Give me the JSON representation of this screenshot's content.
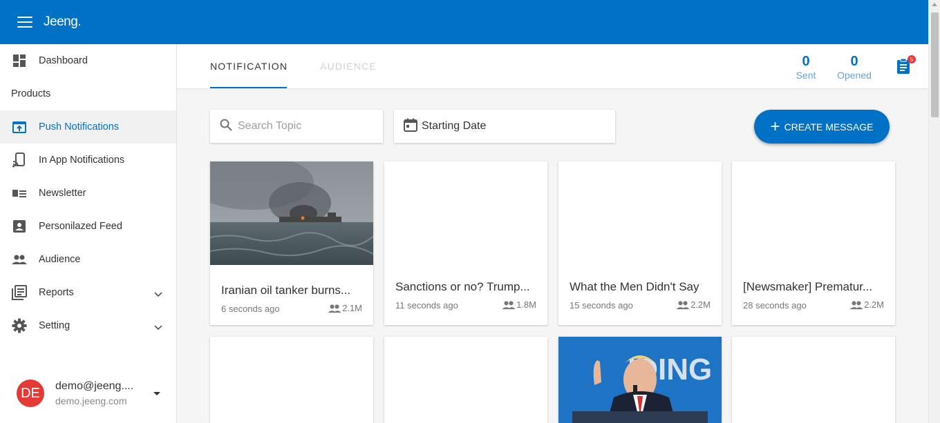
{
  "app": {
    "brand": "Jeeng."
  },
  "sidebar": {
    "items": [
      {
        "label": "Dashboard",
        "icon": "dashboard-icon"
      },
      {
        "label": "Products",
        "section": true
      },
      {
        "label": "Push Notifications",
        "icon": "push-notification-icon",
        "active": true
      },
      {
        "label": "In App Notifications",
        "icon": "cast-icon"
      },
      {
        "label": "Newsletter",
        "icon": "newsletter-icon"
      },
      {
        "label": "Personilazed Feed",
        "icon": "person-card-icon"
      },
      {
        "label": "Audience",
        "icon": "people-icon"
      },
      {
        "label": "Reports",
        "icon": "reports-icon",
        "expandable": true
      },
      {
        "label": "Setting",
        "icon": "gear-icon",
        "expandable": true
      }
    ],
    "user": {
      "initials": "DE",
      "email": "demo@jeeng....",
      "domain": "demo.jeeng.com"
    }
  },
  "header": {
    "tabs": [
      {
        "label": "NOTIFICATION",
        "active": true
      },
      {
        "label": "AUDIENCE",
        "active": false
      }
    ],
    "stats": {
      "sent_value": "0",
      "sent_label": "Sent",
      "opened_value": "0",
      "opened_label": "Opened"
    },
    "report_badge": "5"
  },
  "toolbar": {
    "search_placeholder": "Search Topic",
    "date_label": "Starting Date",
    "create_label": "CREATE MESSAGE"
  },
  "cards": [
    {
      "title": "Iranian oil tanker burns...",
      "time": "6 seconds ago",
      "audience": "2.1M",
      "image": "smoke-over-sea"
    },
    {
      "title": "Sanctions or no? Trump...",
      "time": "11 seconds ago",
      "audience": "1.8M",
      "image": ""
    },
    {
      "title": "What the Men Didn't Say",
      "time": "15 seconds ago",
      "audience": "2.2M",
      "image": ""
    },
    {
      "title": "[Newsmaker] Prematur...",
      "time": "28 seconds ago",
      "audience": "2.2M",
      "image": ""
    },
    {
      "image": ""
    },
    {
      "image": ""
    },
    {
      "image": "speaker-at-podium"
    },
    {
      "image": ""
    }
  ],
  "colors": {
    "primary": "#0072c6",
    "badge": "#e53935",
    "active_bg": "#f1f1f1"
  }
}
